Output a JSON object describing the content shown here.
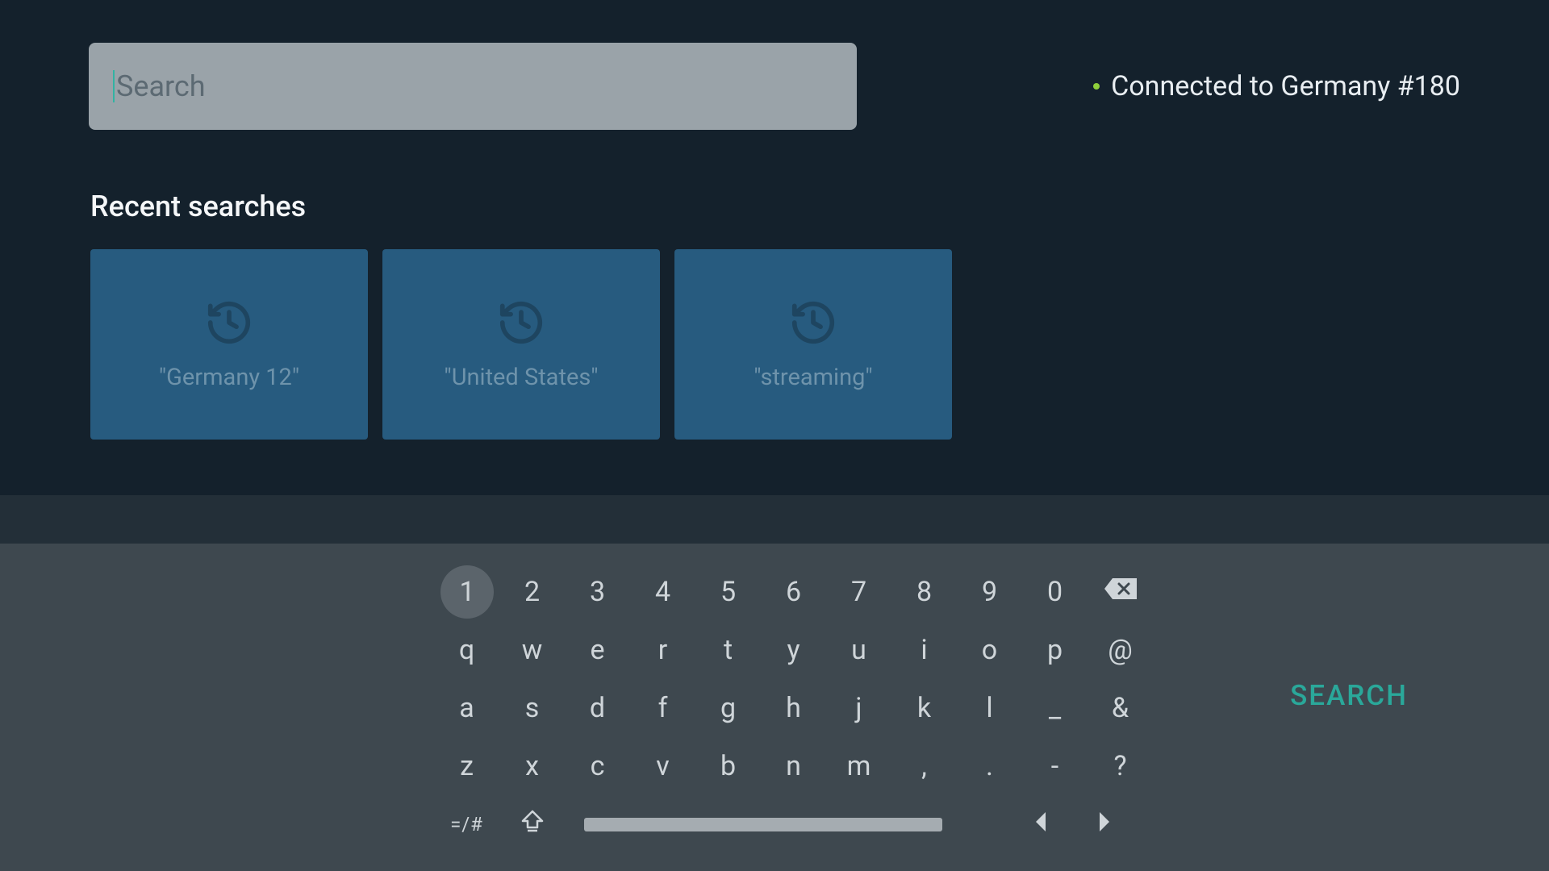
{
  "search": {
    "placeholder": "Search",
    "value": ""
  },
  "status": {
    "text": "Connected to Germany #180"
  },
  "recent": {
    "heading": "Recent searches",
    "items": [
      {
        "label": "\"Germany 12\""
      },
      {
        "label": "\"United States\""
      },
      {
        "label": "\"streaming\""
      }
    ]
  },
  "keyboard": {
    "row1": [
      "1",
      "2",
      "3",
      "4",
      "5",
      "6",
      "7",
      "8",
      "9",
      "0"
    ],
    "row2": [
      "q",
      "w",
      "e",
      "r",
      "t",
      "y",
      "u",
      "i",
      "o",
      "p",
      "@"
    ],
    "row3": [
      "a",
      "s",
      "d",
      "f",
      "g",
      "h",
      "j",
      "k",
      "l",
      "_",
      "&"
    ],
    "row4": [
      "z",
      "x",
      "c",
      "v",
      "b",
      "n",
      "m",
      ",",
      ".",
      "-",
      "?"
    ],
    "sym_label": "=/#",
    "search_label": "SEARCH",
    "focused_key": "1"
  }
}
